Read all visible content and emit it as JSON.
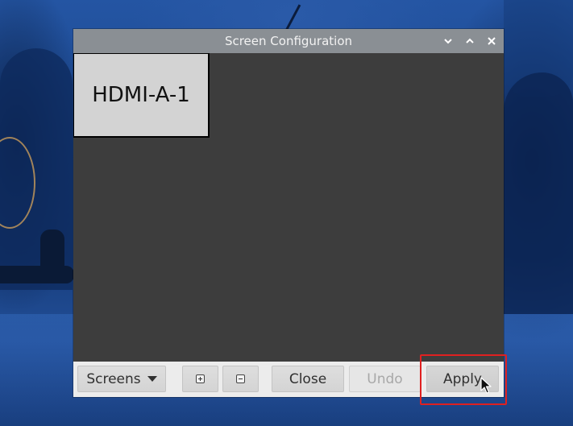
{
  "window": {
    "title": "Screen Configuration",
    "controls": {
      "minimize_icon": "chevron-down-icon",
      "maximize_icon": "chevron-up-icon",
      "close_icon": "close-icon"
    }
  },
  "canvas": {
    "monitors": [
      {
        "label": "HDMI-A-1"
      }
    ]
  },
  "toolbar": {
    "screens_label": "Screens",
    "zoom_in_icon": "zoom-in-icon",
    "zoom_out_icon": "zoom-out-icon",
    "close_label": "Close",
    "undo_label": "Undo",
    "apply_label": "Apply"
  },
  "highlight_color": "#e02020"
}
